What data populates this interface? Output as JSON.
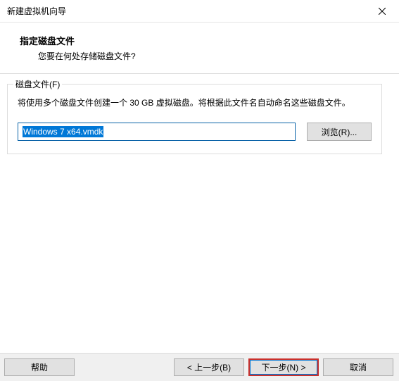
{
  "window": {
    "title": "新建虚拟机向导"
  },
  "header": {
    "title": "指定磁盘文件",
    "subtitle": "您要在何处存储磁盘文件?"
  },
  "fieldset": {
    "legend": "磁盘文件(F)",
    "description": "将使用多个磁盘文件创建一个 30 GB 虚拟磁盘。将根据此文件名自动命名这些磁盘文件。",
    "file_value": "Windows 7 x64.vmdk",
    "browse_label": "浏览(R)..."
  },
  "footer": {
    "help_label": "帮助",
    "back_label": "< 上一步(B)",
    "next_label": "下一步(N) >",
    "cancel_label": "取消"
  }
}
